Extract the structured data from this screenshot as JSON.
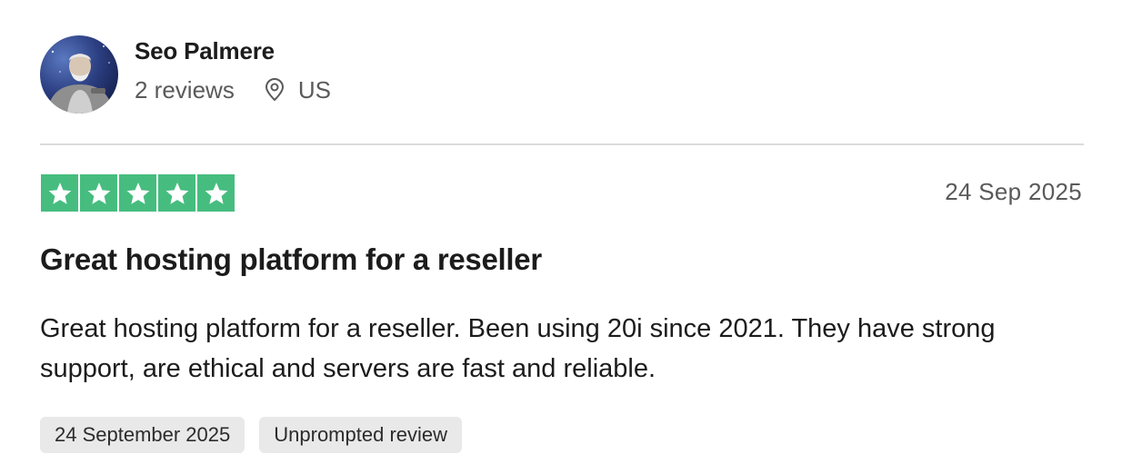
{
  "reviewer": {
    "name": "Seo Palmere",
    "review_count": "2 reviews",
    "location_icon": "map-pin-icon",
    "location": "US"
  },
  "review": {
    "rating": 5,
    "rating_max": 5,
    "star_color": "#46bd7f",
    "date_short": "24 Sep 2025",
    "title": "Great hosting platform for a reseller",
    "body": "Great hosting platform for a reseller. Been using 20i since 2021. They have strong support, are ethical and servers are fast and reliable.",
    "tags": [
      {
        "label": "24 September 2025"
      },
      {
        "label": "Unprompted review"
      }
    ]
  }
}
